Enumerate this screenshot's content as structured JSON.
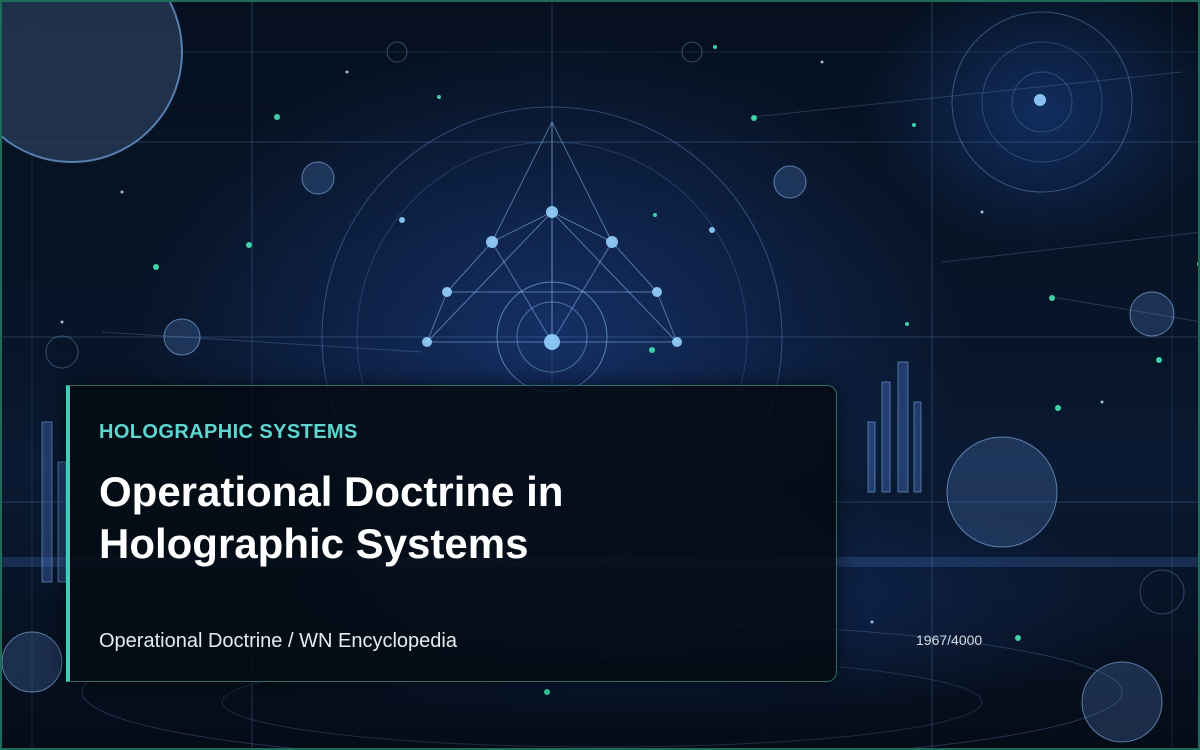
{
  "card": {
    "category": "HOLOGRAPHIC SYSTEMS",
    "title": "Operational Doctrine in Holographic Systems",
    "breadcrumb": "Operational Doctrine / WN Encyclopedia"
  },
  "counter": "1967/4000",
  "colors": {
    "accent": "#48c9b8",
    "category_text": "#5ed6cf",
    "frame_border": "#1f6b5a",
    "background": "#050b18"
  }
}
